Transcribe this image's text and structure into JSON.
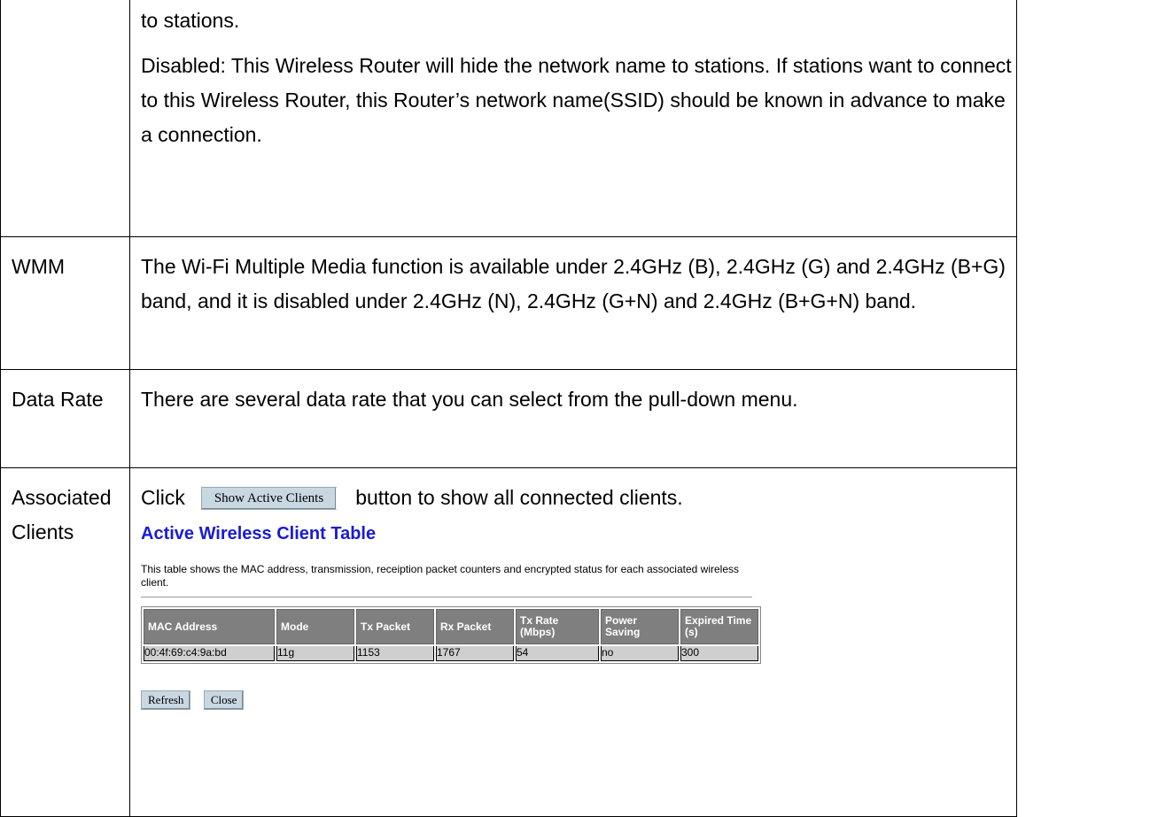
{
  "rows": [
    {
      "name": "",
      "paragraphs": [
        "to stations.",
        "Disabled: This Wireless Router will hide the network name to stations. If stations want to connect to this Wireless Router, this Router’s network name(SSID) should be known in advance to make a connection."
      ]
    },
    {
      "name": "WMM",
      "paragraphs": [
        "The Wi-Fi Multiple Media function is available under 2.4GHz (B), 2.4GHz (G) and 2.4GHz (B+G) band, and it is disabled under 2.4GHz (N), 2.4GHz (G+N) and 2.4GHz (B+G+N) band."
      ]
    },
    {
      "name": "Data Rate",
      "paragraphs": [
        "There are several data rate that you can select from the pull-down menu."
      ]
    },
    {
      "name": "Associated Clients",
      "click_prefix": "Click",
      "click_suffix": "button to show all connected clients."
    }
  ],
  "show_button_label": "Show Active Clients",
  "client_table": {
    "title": "Active Wireless Client Table",
    "description": "This table shows the MAC address, transmission, receiption packet counters and encrypted status for each associated wireless client.",
    "headers": [
      "MAC Address",
      "Mode",
      "Tx Packet",
      "Rx Packet",
      "Tx Rate (Mbps)",
      "Power Saving",
      "Expired Time (s)"
    ],
    "rows": [
      [
        "00:4f:69:c4:9a:bd",
        "11g",
        "1153",
        "1767",
        "54",
        "no",
        "300"
      ]
    ],
    "refresh_label": "Refresh",
    "close_label": "Close"
  }
}
